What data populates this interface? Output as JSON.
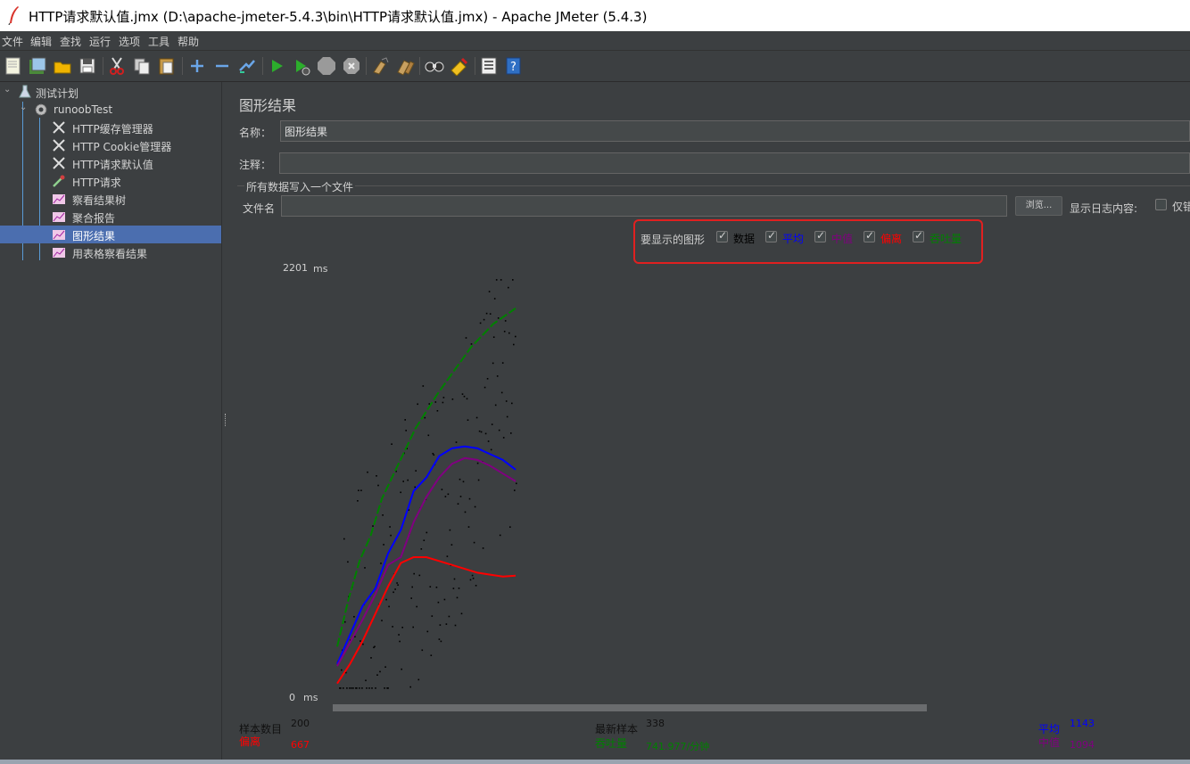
{
  "window": {
    "title": "HTTP请求默认值.jmx (D:\\apache-jmeter-5.4.3\\bin\\HTTP请求默认值.jmx) - Apache JMeter (5.4.3)"
  },
  "menu": [
    "文件",
    "编辑",
    "查找",
    "运行",
    "选项",
    "工具",
    "帮助"
  ],
  "toolbar": {
    "buttons": [
      "new-icon",
      "templates-icon",
      "open-icon",
      "save-icon",
      "cut-icon",
      "copy-icon",
      "paste-icon",
      "expand-icon",
      "collapse-icon",
      "toggle-icon",
      "start-icon",
      "start-no-pause-icon",
      "stop-icon",
      "shutdown-icon",
      "clear-icon",
      "clear-all-icon",
      "search-icon",
      "reset-search-icon",
      "function-helper-icon",
      "help-icon"
    ]
  },
  "tree": {
    "root": "测试计划",
    "thread_group": "runoobTest",
    "items": [
      "HTTP缓存管理器",
      "HTTP Cookie管理器",
      "HTTP请求默认值",
      "HTTP请求",
      "察看结果树",
      "聚合报告",
      "图形结果",
      "用表格察看结果"
    ],
    "selected_index": 6
  },
  "panel": {
    "heading": "图形结果",
    "name_label": "名称：",
    "name_value": "图形结果",
    "comment_label": "注释：",
    "comment_value": "",
    "file_section": "所有数据写入一个文件",
    "filename_label": "文件名",
    "filename_value": "",
    "browse_button": "浏览...",
    "log_label": "显示日志内容:",
    "errors_only_label": "仅错"
  },
  "graph_options": {
    "label": "要显示的图形",
    "items": [
      {
        "label": "数据",
        "checked": true,
        "color": "#000000"
      },
      {
        "label": "平均",
        "checked": true,
        "color": "#0000ff"
      },
      {
        "label": "中值",
        "checked": true,
        "color": "#800080"
      },
      {
        "label": "偏离",
        "checked": true,
        "color": "#ff0000"
      },
      {
        "label": "吞吐量",
        "checked": true,
        "color": "#008000"
      }
    ]
  },
  "chart_data": {
    "type": "line",
    "y_max_label": "2201",
    "y_min_label": "0",
    "y_unit": "ms",
    "ylim": [
      0,
      2201
    ],
    "x_samples": [
      1,
      200
    ],
    "series": [
      {
        "name": "吞吐量",
        "color": "#008000",
        "values": [
          260,
          500,
          700,
          830,
          1020,
          1140,
          1260,
          1380,
          1470,
          1560,
          1640,
          1720,
          1800,
          1860,
          1920,
          1960,
          2000
        ]
      },
      {
        "name": "平均",
        "color": "#0000ff",
        "values": [
          170,
          320,
          470,
          560,
          740,
          860,
          1060,
          1130,
          1240,
          1280,
          1290,
          1280,
          1250,
          1220,
          1170
        ]
      },
      {
        "name": "中值",
        "color": "#800080",
        "values": [
          160,
          280,
          400,
          530,
          680,
          720,
          900,
          1030,
          1130,
          1200,
          1230,
          1220,
          1190,
          1150,
          1110
        ]
      },
      {
        "name": "偏离",
        "color": "#ff0000",
        "values": [
          70,
          170,
          290,
          430,
          570,
          690,
          720,
          720,
          700,
          680,
          660,
          640,
          630,
          620,
          625
        ]
      }
    ]
  },
  "stats": {
    "samples_label": "样本数目",
    "samples_value": "200",
    "deviation_label": "偏离",
    "deviation_value": "667",
    "latest_label": "最新样本",
    "latest_value": "338",
    "throughput_label": "吞吐量",
    "throughput_value": "741.977/分钟",
    "average_label": "平均",
    "average_value": "1143",
    "median_label": "中值",
    "median_value": "1094"
  }
}
